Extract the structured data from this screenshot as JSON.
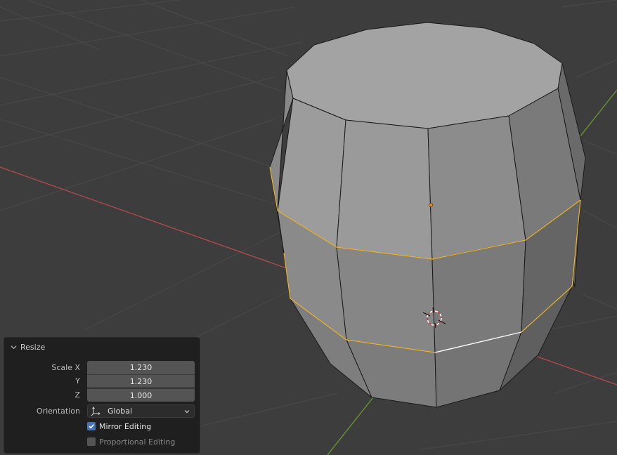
{
  "viewport": {
    "background": "#3d3d3d",
    "x_axis_color": "#b34a4a",
    "y_axis_color": "#6b9a2e",
    "selected_edge_color": "#f0b72f",
    "active_edge_color": "#ffffff",
    "mesh_object": "barrel",
    "cursor_icon": "3d-cursor-icon",
    "origin_icon": "object-origin-icon"
  },
  "operator_panel": {
    "title": "Resize",
    "scale": {
      "x_label": "Scale X",
      "x_value": "1.230",
      "y_label": "Y",
      "y_value": "1.230",
      "z_label": "Z",
      "z_value": "1.000"
    },
    "orientation": {
      "label": "Orientation",
      "value": "Global",
      "icon": "orientation-axes-icon"
    },
    "mirror_editing": {
      "label": "Mirror Editing",
      "checked": true
    },
    "proportional_editing": {
      "label": "Proportional Editing",
      "checked": false
    },
    "accent_color": "#4772b3"
  }
}
